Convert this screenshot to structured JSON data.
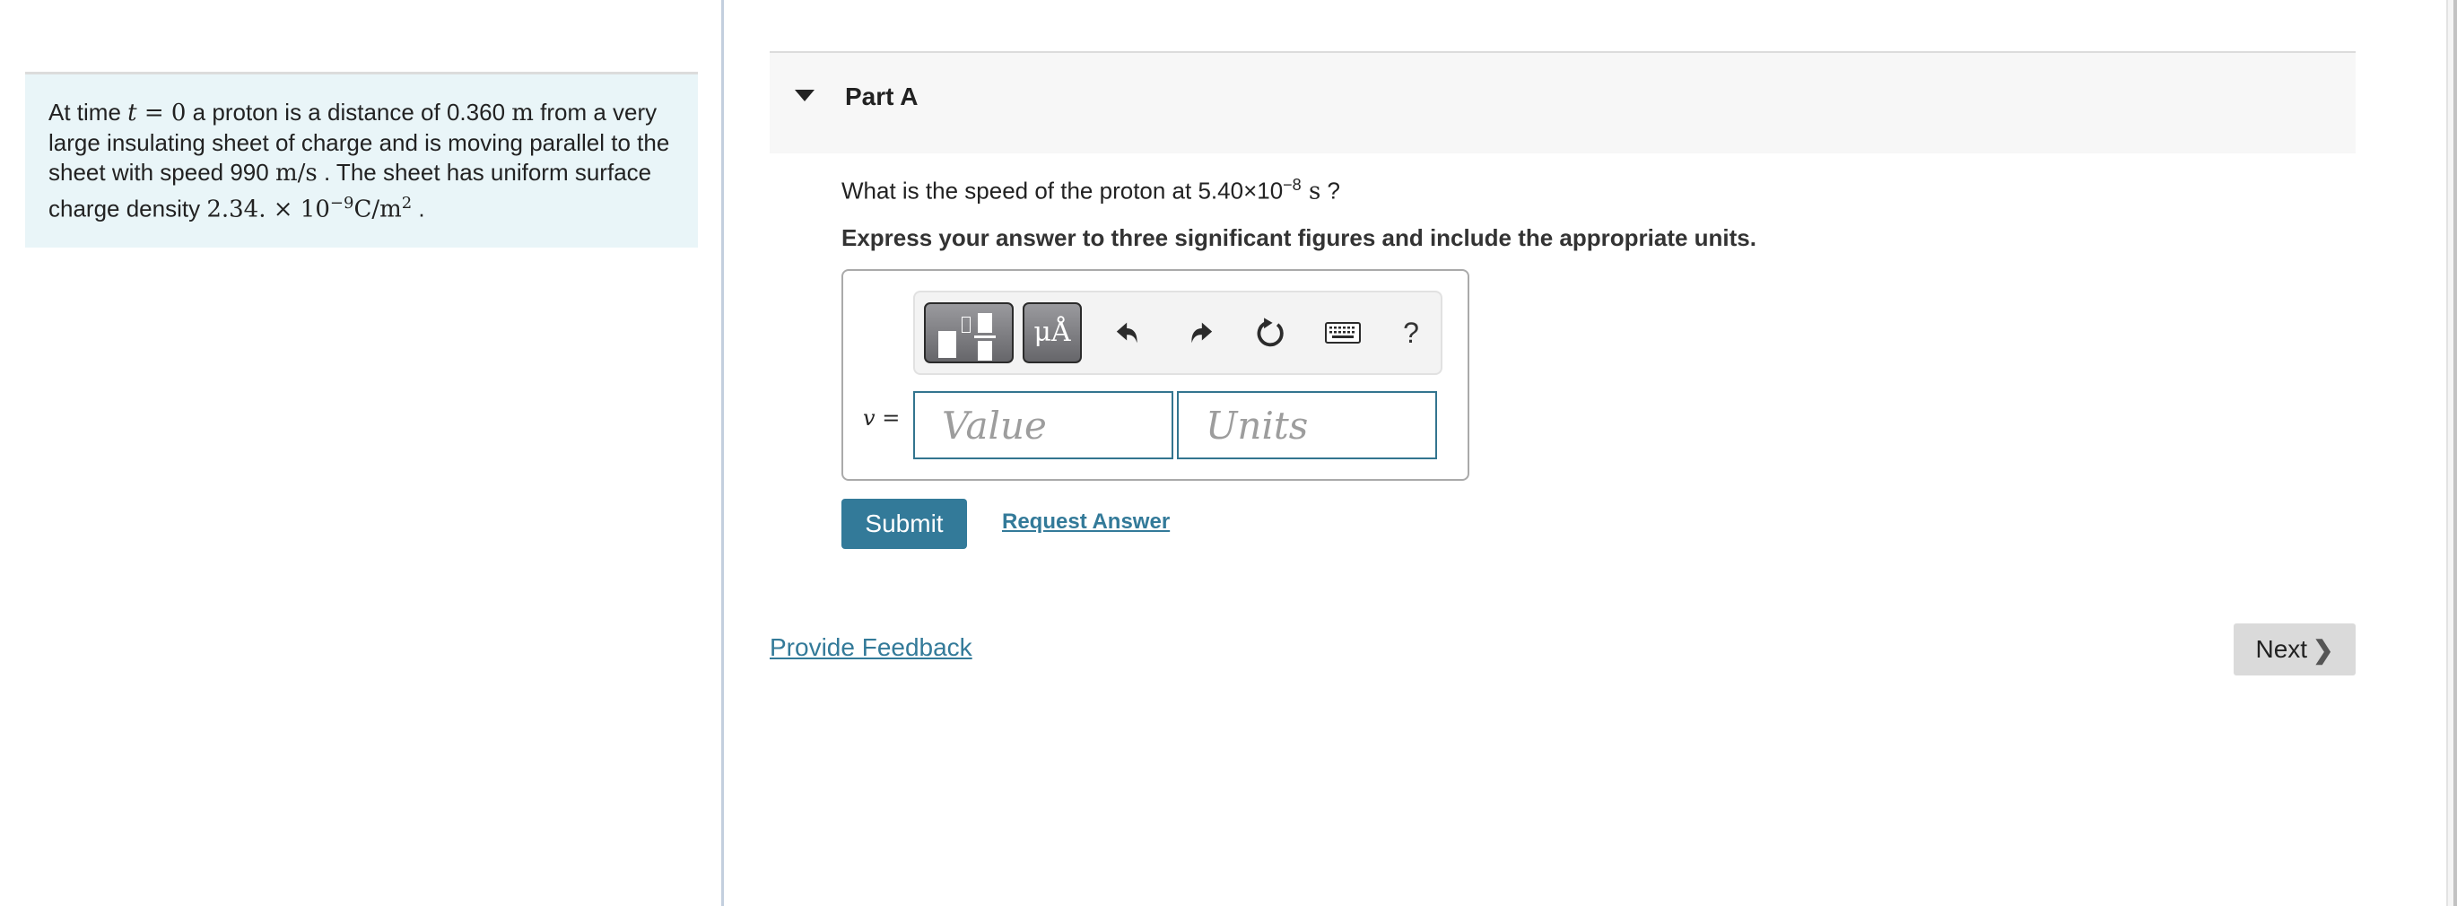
{
  "problem": {
    "text_1": "At time ",
    "t_var": "t",
    "eq_zero": " = 0",
    "text_2": " a proton is a distance of 0.360 ",
    "unit_m": "m",
    "text_3": " from a very large insulating sheet of charge and is moving parallel to the sheet with speed 990 ",
    "unit_speed": "m/s",
    "text_4": " . The sheet has uniform surface charge density ",
    "density_value": "2.34. × 10",
    "density_exp": "−9",
    "density_unit": "C/m",
    "density_unit_exp": "2",
    "text_5": " ."
  },
  "part": {
    "title": "Part A",
    "question_prefix": "What is the speed of the proton at 5.40×10",
    "question_exp": "−8",
    "question_unit": " s",
    "question_suffix": " ?",
    "instruction": "Express your answer to three significant figures and include the appropriate units."
  },
  "answer": {
    "variable_label": "v =",
    "value_placeholder": "Value",
    "units_placeholder": "Units",
    "value": "",
    "units": ""
  },
  "toolbar": {
    "units_button_label": "μÅ",
    "help_label": "?",
    "icons": [
      "templates-icon",
      "units-icon",
      "undo-icon",
      "redo-icon",
      "reset-icon",
      "keyboard-icon",
      "help-icon"
    ]
  },
  "actions": {
    "submit_label": "Submit",
    "request_answer_label": "Request Answer",
    "provide_feedback_label": "Provide Feedback",
    "next_label": "Next",
    "next_chevron": "❯"
  },
  "colors": {
    "accent": "#337a99",
    "problem_bg": "#e9f5f8",
    "part_header_bg": "#f7f7f7",
    "next_bg": "#dadada"
  }
}
